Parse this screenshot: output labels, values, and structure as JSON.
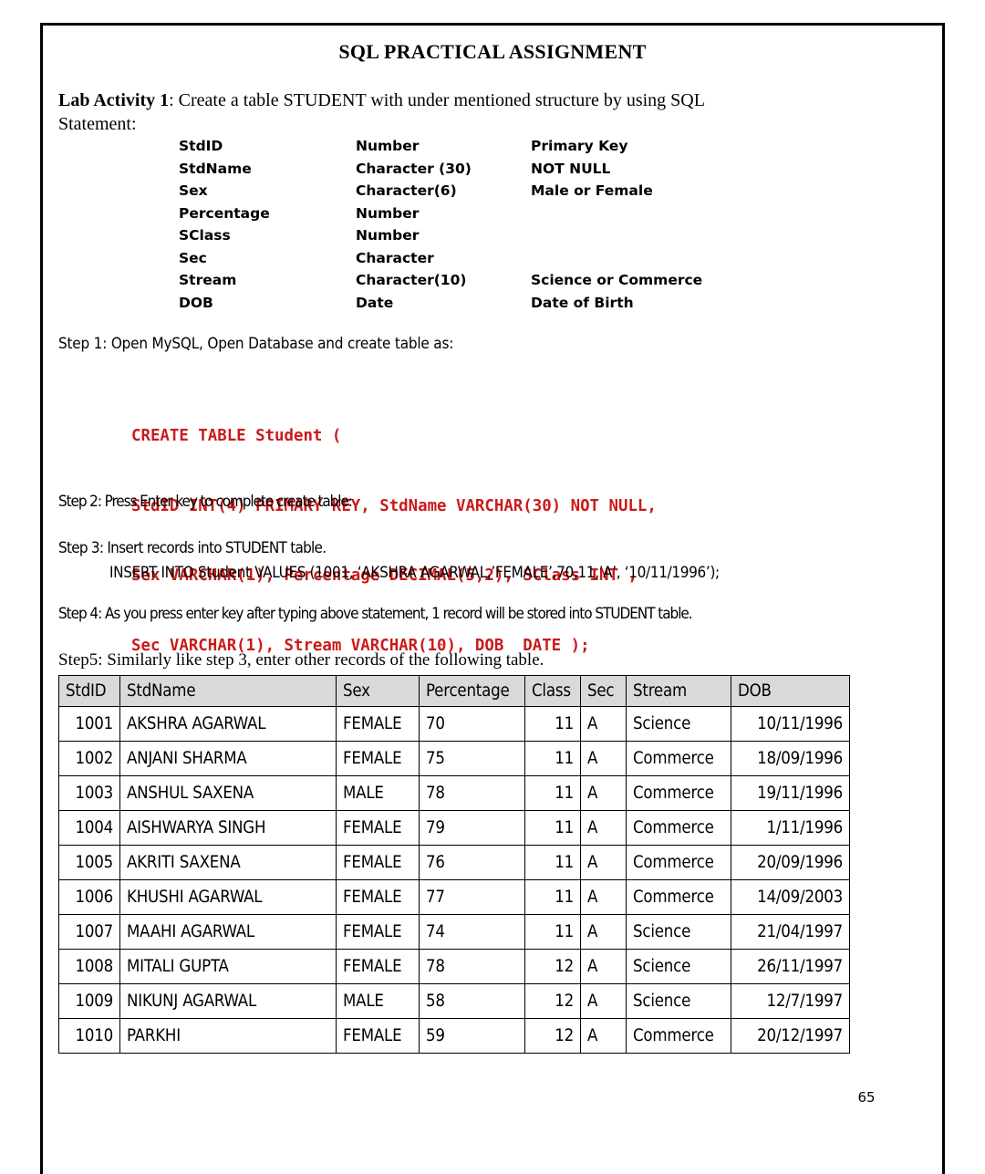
{
  "document": {
    "title": "SQL PRACTICAL ASSIGNMENT",
    "page_number": "65",
    "accent_color": "#cc1a1a",
    "header_fill": "#d9d9d9"
  },
  "lab_activity": {
    "label": "Lab Activity 1",
    "intro_rest": ": Create a table STUDENT with under mentioned structure by using SQL",
    "statement_line": "Statement:"
  },
  "spec": {
    "rows": [
      {
        "field": "StdID",
        "type": "Number",
        "note": "Primary Key"
      },
      {
        "field": "StdName",
        "type": "Character (30)",
        "note": "NOT NULL"
      },
      {
        "field": "Sex",
        "type": "Character(6)",
        "note": "Male or Female"
      },
      {
        "field": "Percentage",
        "type": "Number",
        "note": ""
      },
      {
        "field": "SClass",
        "type": "Number",
        "note": ""
      },
      {
        "field": "Sec",
        "type": "Character",
        "note": ""
      },
      {
        "field": "Stream",
        "type": "Character(10)",
        "note": "Science or Commerce"
      },
      {
        "field": "DOB",
        "type": "Date",
        "note": "Date of Birth"
      }
    ]
  },
  "steps": {
    "step1": "Step 1: Open MySQL, Open Database and create table as:",
    "step2": "Step 2: Press Enter key to complete create table:",
    "step3": "Step 3:  Insert records into STUDENT table.",
    "step3_insert": "INSERT INTO Student VALUES (1001, ‘AKSHRA AGARWAL,’FEMALE’,70,11,’A’, ‘10/11/1996’);",
    "step4": "Step 4: As you press enter key after typing above statement, 1 record will be stored into STUDENT table.",
    "step5": "Step5: Similarly like step 3, enter other records of the following table."
  },
  "sql": {
    "lines": [
      "CREATE TABLE Student (",
      "StdID INT(4) PRIMARY KEY, StdName VARCHAR(30) NOT NULL,",
      "Sex VARCHAR(1), Percentage DECIMAL(5,2), SClass INT ,",
      "Sec VARCHAR(1), Stream VARCHAR(10), DOB  DATE );"
    ]
  },
  "student_table": {
    "headers": [
      "StdID",
      "StdName",
      "Sex",
      "Percentage",
      "Class",
      "Sec",
      "Stream",
      "DOB"
    ],
    "rows": [
      {
        "stdid": "1001",
        "stdname": "AKSHRA AGARWAL",
        "sex": "FEMALE",
        "percentage": "70",
        "class": "11",
        "sec": "A",
        "stream": "Science",
        "dob": "10/11/1996"
      },
      {
        "stdid": "1002",
        "stdname": "ANJANI SHARMA",
        "sex": "FEMALE",
        "percentage": "75",
        "class": "11",
        "sec": "A",
        "stream": "Commerce",
        "dob": "18/09/1996"
      },
      {
        "stdid": "1003",
        "stdname": "ANSHUL SAXENA",
        "sex": "MALE",
        "percentage": "78",
        "class": "11",
        "sec": "A",
        "stream": "Commerce",
        "dob": "19/11/1996"
      },
      {
        "stdid": "1004",
        "stdname": "AISHWARYA SINGH",
        "sex": "FEMALE",
        "percentage": "79",
        "class": "11",
        "sec": "A",
        "stream": "Commerce",
        "dob": "1/11/1996"
      },
      {
        "stdid": "1005",
        "stdname": "AKRITI SAXENA",
        "sex": "FEMALE",
        "percentage": "76",
        "class": "11",
        "sec": "A",
        "stream": "Commerce",
        "dob": "20/09/1996"
      },
      {
        "stdid": "1006",
        "stdname": "KHUSHI AGARWAL",
        "sex": "FEMALE",
        "percentage": "77",
        "class": "11",
        "sec": "A",
        "stream": "Commerce",
        "dob": "14/09/2003"
      },
      {
        "stdid": "1007",
        "stdname": "MAAHI AGARWAL",
        "sex": "FEMALE",
        "percentage": "74",
        "class": "11",
        "sec": "A",
        "stream": "Science",
        "dob": "21/04/1997"
      },
      {
        "stdid": "1008",
        "stdname": "MITALI GUPTA",
        "sex": "FEMALE",
        "percentage": "78",
        "class": "12",
        "sec": "A",
        "stream": "Science",
        "dob": "26/11/1997"
      },
      {
        "stdid": "1009",
        "stdname": "NIKUNJ AGARWAL",
        "sex": "MALE",
        "percentage": "58",
        "class": "12",
        "sec": "A",
        "stream": "Science",
        "dob": "12/7/1997"
      },
      {
        "stdid": "1010",
        "stdname": "PARKHI",
        "sex": "FEMALE",
        "percentage": "59",
        "class": "12",
        "sec": "A",
        "stream": "Commerce",
        "dob": "20/12/1997"
      }
    ]
  }
}
